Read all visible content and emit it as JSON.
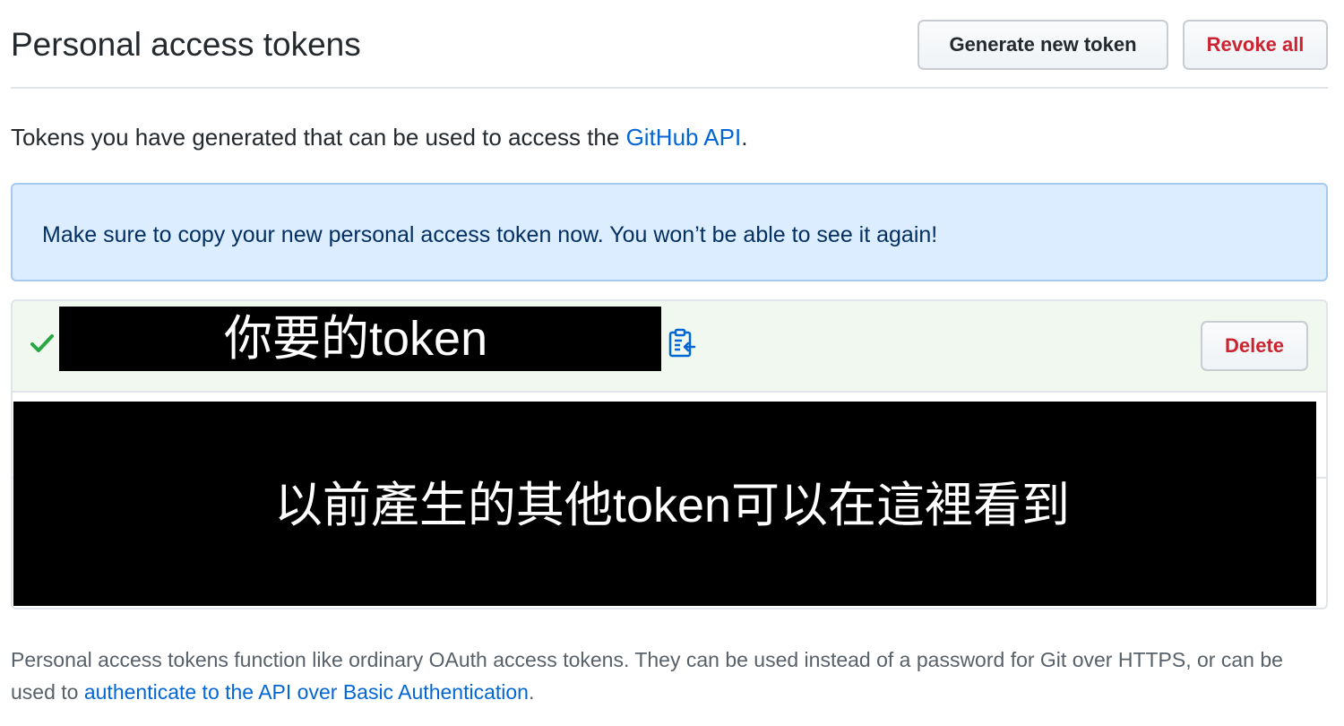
{
  "header": {
    "title": "Personal access tokens",
    "generate_label": "Generate new token",
    "revoke_label": "Revoke all"
  },
  "intro": {
    "text": "Tokens you have generated that can be used to access the ",
    "link": "GitHub API",
    "suffix": "."
  },
  "flash": {
    "message": "Make sure to copy your new personal access token now. You won’t be able to see it again!"
  },
  "new_token": {
    "masked_label": "你要的token",
    "delete_label": "Delete",
    "icons": {
      "check": "check-icon",
      "copy": "clipboard-icon"
    }
  },
  "old_tokens": {
    "masked_label": "以前產生的其他token可以在這裡看到"
  },
  "footer": {
    "text": "Personal access tokens function like ordinary OAuth access tokens. They can be used instead of a password for Git over HTTPS, or can be used to ",
    "link": "authenticate to the API over Basic Authentication",
    "suffix": "."
  },
  "colors": {
    "link": "#0366d6",
    "danger": "#cb2431",
    "flash_bg": "#dbedff",
    "success_bg": "#f0f8ef",
    "check": "#28a745"
  }
}
